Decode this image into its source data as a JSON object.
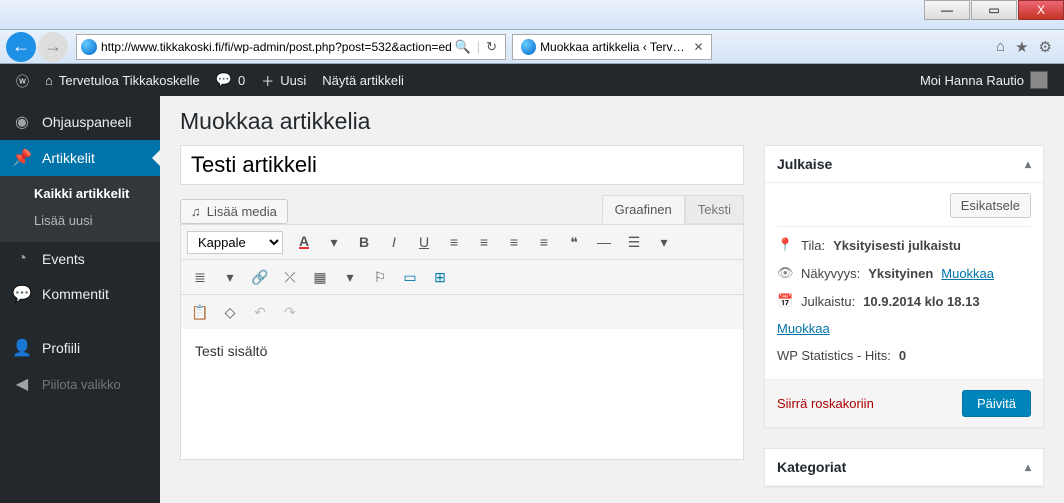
{
  "win": {
    "min": "—",
    "max": "▭",
    "close": "X"
  },
  "browser": {
    "url": "http://www.tikkakoski.fi/fi/wp-admin/post.php?post=532&action=ed",
    "tab_title": "Muokkaa artikkelia ‹ Tervet…"
  },
  "adminbar": {
    "site_name": "Tervetuloa Tikkakoskelle",
    "comments": "0",
    "new": "Uusi",
    "view": "Näytä artikkeli",
    "greeting": "Moi Hanna Rautio"
  },
  "menu": {
    "dashboard": "Ohjauspaneeli",
    "posts": "Artikkelit",
    "posts_sub_all": "Kaikki artikkelit",
    "posts_sub_new": "Lisää uusi",
    "events": "Events",
    "comments": "Kommentit",
    "profile": "Profiili",
    "collapse": "Piilota valikko"
  },
  "page": {
    "heading": "Muokkaa artikkelia",
    "title_value": "Testi artikkeli",
    "add_media": "Lisää media",
    "tab_visual": "Graafinen",
    "tab_text": "Teksti",
    "format_select": "Kappale",
    "content": "Testi sisältö"
  },
  "publish": {
    "box_title": "Julkaise",
    "preview": "Esikatsele",
    "status_label": "Tila:",
    "status_value": "Yksityisesti julkaistu",
    "vis_label": "Näkyvyys:",
    "vis_value": "Yksityinen",
    "edit": "Muokkaa",
    "pub_label": "Julkaistu:",
    "pub_value": "10.9.2014 klo 18.13",
    "stats_label": "WP Statistics - Hits:",
    "stats_value": "0",
    "trash": "Siirrä roskakoriin",
    "update": "Päivitä"
  },
  "categories": {
    "box_title": "Kategoriat"
  }
}
